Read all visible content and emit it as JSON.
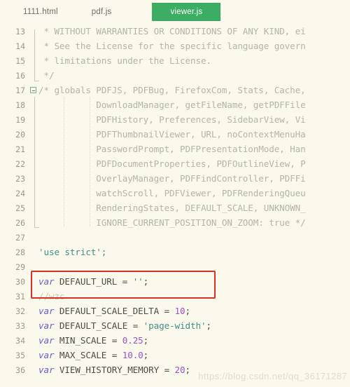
{
  "window": {
    "background": "#fbf8ec",
    "accent_green": "#3cae63",
    "highlight_red": "#d93025"
  },
  "tabs": [
    {
      "label": "1111.html",
      "active": false
    },
    {
      "label": "pdf.js",
      "active": false
    },
    {
      "label": "viewer.js",
      "active": true
    }
  ],
  "editor": {
    "first_line": 13,
    "last_line": 36,
    "lines": [
      {
        "n": "13",
        "tokens": [
          {
            "t": " * WITHOUT WARRANTIES OR CONDITIONS OF ANY KIND, ei",
            "c": "cmt"
          }
        ]
      },
      {
        "n": "14",
        "tokens": [
          {
            "t": " * See the License for the specific language govern",
            "c": "cmt"
          }
        ]
      },
      {
        "n": "15",
        "tokens": [
          {
            "t": " * limitations under the License.",
            "c": "cmt"
          }
        ]
      },
      {
        "n": "16",
        "tokens": [
          {
            "t": " */",
            "c": "cmt"
          }
        ]
      },
      {
        "n": "17",
        "tokens": [
          {
            "t": "/* globals PDFJS, PDFBug, FirefoxCom, Stats, Cache,",
            "c": "cmt"
          }
        ]
      },
      {
        "n": "18",
        "tokens": [
          {
            "t": "           DownloadManager, getFileName, getPDFFile",
            "c": "cmt"
          }
        ]
      },
      {
        "n": "19",
        "tokens": [
          {
            "t": "           PDFHistory, Preferences, SidebarView, Vi",
            "c": "cmt"
          }
        ]
      },
      {
        "n": "20",
        "tokens": [
          {
            "t": "           PDFThumbnailViewer, URL, noContextMenuHa",
            "c": "cmt"
          }
        ]
      },
      {
        "n": "21",
        "tokens": [
          {
            "t": "           PasswordPrompt, PDFPresentationMode, Han",
            "c": "cmt"
          }
        ]
      },
      {
        "n": "22",
        "tokens": [
          {
            "t": "           PDFDocumentProperties, PDFOutlineView, P",
            "c": "cmt"
          }
        ]
      },
      {
        "n": "23",
        "tokens": [
          {
            "t": "           OverlayManager, PDFFindController, PDFFi",
            "c": "cmt"
          }
        ]
      },
      {
        "n": "24",
        "tokens": [
          {
            "t": "           watchScroll, PDFViewer, PDFRenderingQueu",
            "c": "cmt"
          }
        ]
      },
      {
        "n": "25",
        "tokens": [
          {
            "t": "           RenderingStates, DEFAULT_SCALE, UNKNOWN_",
            "c": "cmt"
          }
        ]
      },
      {
        "n": "26",
        "tokens": [
          {
            "t": "           IGNORE_CURRENT_POSITION_ON_ZOOM: true */",
            "c": "cmt"
          }
        ]
      },
      {
        "n": "27",
        "tokens": []
      },
      {
        "n": "28",
        "tokens": [
          {
            "t": "'use strict';",
            "c": "str"
          }
        ]
      },
      {
        "n": "29",
        "tokens": []
      },
      {
        "n": "30",
        "tokens": [
          {
            "t": "var",
            "c": "kw"
          },
          {
            "t": " DEFAULT_URL ",
            "c": "id"
          },
          {
            "t": "= ",
            "c": "pun"
          },
          {
            "t": "''",
            "c": "str"
          },
          {
            "t": ";",
            "c": "pun"
          }
        ]
      },
      {
        "n": "31",
        "tokens": [
          {
            "t": "//wzc",
            "c": "cmt2"
          }
        ]
      },
      {
        "n": "32",
        "tokens": [
          {
            "t": "var",
            "c": "kw"
          },
          {
            "t": " DEFAULT_SCALE_DELTA ",
            "c": "id"
          },
          {
            "t": "= ",
            "c": "pun"
          },
          {
            "t": "10",
            "c": "num"
          },
          {
            "t": ";",
            "c": "pun"
          }
        ]
      },
      {
        "n": "33",
        "tokens": [
          {
            "t": "var",
            "c": "kw"
          },
          {
            "t": " DEFAULT_SCALE ",
            "c": "id"
          },
          {
            "t": "= ",
            "c": "pun"
          },
          {
            "t": "'page-width'",
            "c": "str"
          },
          {
            "t": ";",
            "c": "pun"
          }
        ]
      },
      {
        "n": "34",
        "tokens": [
          {
            "t": "var",
            "c": "kw"
          },
          {
            "t": " MIN_SCALE ",
            "c": "id"
          },
          {
            "t": "= ",
            "c": "pun"
          },
          {
            "t": "0.25",
            "c": "num"
          },
          {
            "t": ";",
            "c": "pun"
          }
        ]
      },
      {
        "n": "35",
        "tokens": [
          {
            "t": "var",
            "c": "kw"
          },
          {
            "t": " MAX_SCALE ",
            "c": "id"
          },
          {
            "t": "= ",
            "c": "pun"
          },
          {
            "t": "10.0",
            "c": "num"
          },
          {
            "t": ";",
            "c": "pun"
          }
        ]
      },
      {
        "n": "36",
        "tokens": [
          {
            "t": "var",
            "c": "kw"
          },
          {
            "t": " VIEW_HISTORY_MEMORY ",
            "c": "id"
          },
          {
            "t": "= ",
            "c": "pun"
          },
          {
            "t": "20",
            "c": "num"
          },
          {
            "t": ";",
            "c": "pun"
          }
        ]
      }
    ],
    "fold_marker_line": "17",
    "fold_guide": {
      "from_line": "13",
      "to_line": "16"
    },
    "fold_guide2": {
      "from_line": "17",
      "to_line": "26"
    }
  },
  "annotation": {
    "type": "red-rectangle",
    "covers_lines": [
      "30",
      "31"
    ],
    "color": "#d93025"
  },
  "watermark": {
    "text": "https://blog.csdn.net/qq_36171287"
  }
}
